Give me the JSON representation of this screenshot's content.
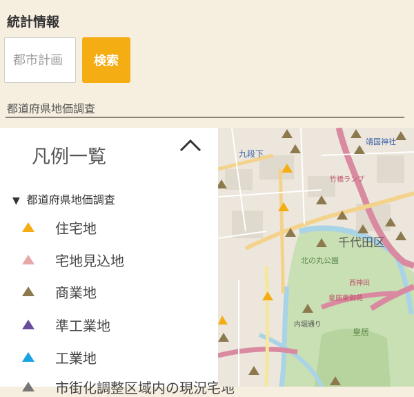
{
  "sidebar": {
    "title": "統計情報",
    "search": {
      "placeholder": "都市計画",
      "button_label": "検索"
    },
    "layer_label": "都道府県地価調査"
  },
  "legend": {
    "title": "凡例一覧",
    "group_label": "都道府県地価調査",
    "items": [
      {
        "label": "住宅地",
        "color": "#f4ad12"
      },
      {
        "label": "宅地見込地",
        "color": "#e8a8a8"
      },
      {
        "label": "商業地",
        "color": "#8c7a4e"
      },
      {
        "label": "準工業地",
        "color": "#6a4c9c"
      },
      {
        "label": "工業地",
        "color": "#1aa3e0"
      },
      {
        "label": "市街化調整区域内の現況宅地",
        "color": "#777777"
      }
    ]
  },
  "map": {
    "labels": {
      "station": "九段下",
      "district": "千代田区",
      "park": "北の丸公園",
      "palace": "皇居",
      "palace_annex": "皇居東御苑",
      "street": "内堀通り",
      "pin_label": "靖国神社",
      "ramp": "竹橋ランプ",
      "west": "西神田"
    },
    "marker_colors": {
      "residential": "#f4ad12",
      "commercial": "#8c7a4e"
    }
  }
}
